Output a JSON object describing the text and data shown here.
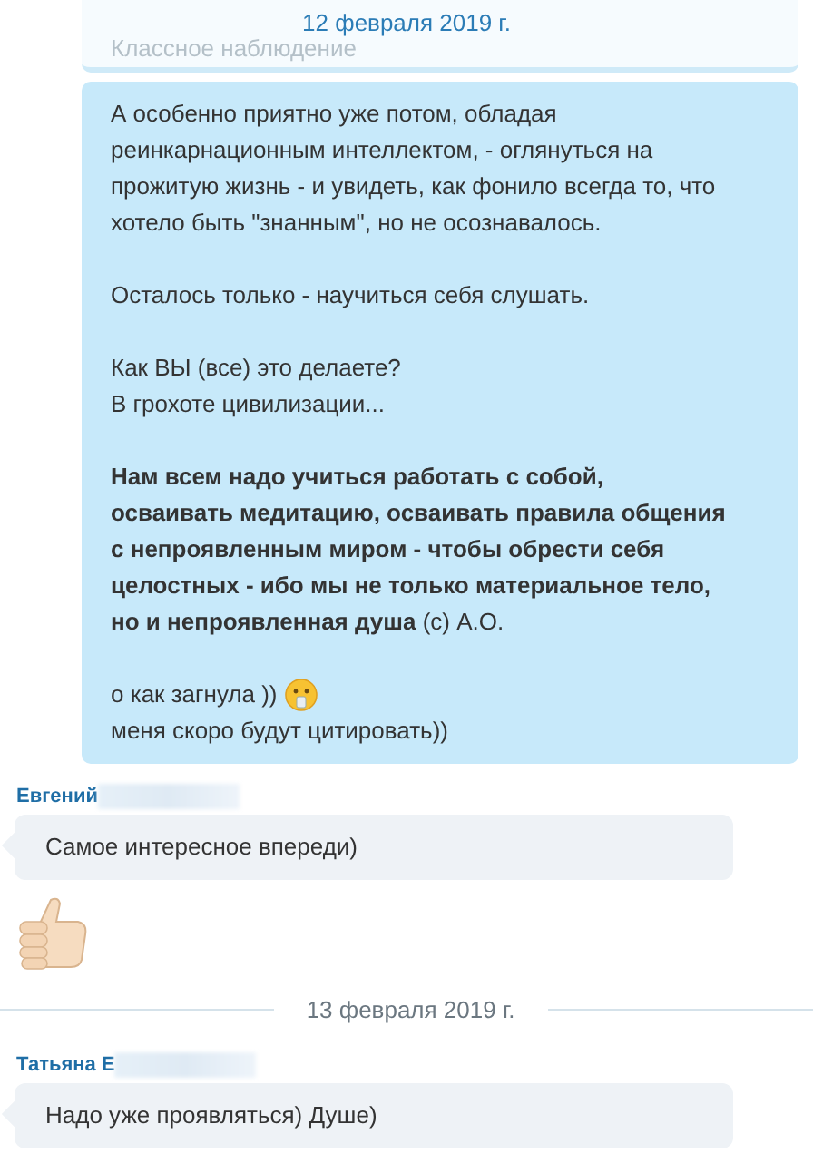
{
  "sticky_date": "12 февраля 2019 г.",
  "messages": [
    {
      "kind": "outgoing",
      "faded": true,
      "blocks": [
        [
          {
            "text": "Классное наблюдение"
          }
        ]
      ]
    },
    {
      "kind": "outgoing",
      "blocks": [
        [
          {
            "text": "А особенно приятно уже потом, обладая реинкарнационным интеллектом, - оглянуться на прожитую жизнь - и увидеть, как фонило всегда то, что хотело быть \"знанным\", но не осознавалось."
          }
        ],
        [
          {
            "text": "Осталось только - научиться себя слушать."
          }
        ],
        [
          {
            "text": "Как ВЫ (все) это делаете?"
          },
          {
            "text": "В грохоте цивилизации..."
          }
        ],
        [
          {
            "text": "**Нам всем надо учиться работать с собой, осваивать медитацию, осваивать правила общения с непроявленным миром - чтобы обрести себя целостных - ибо мы не только материальное тело, но и непроявленная душа** (с)  А.О."
          }
        ],
        [
          {
            "text": "о как загнула ))",
            "emoji": true
          },
          {
            "text": "меня скоро будут цитировать))"
          }
        ]
      ]
    },
    {
      "kind": "incoming",
      "sender": "Евгений",
      "blocks": [
        [
          {
            "text": "Самое интересное впереди)"
          }
        ]
      ]
    },
    {
      "kind": "sticker"
    },
    {
      "kind": "date",
      "text": "13 февраля 2019 г."
    },
    {
      "kind": "incoming",
      "sender": "Татьяна Е",
      "blocks": [
        [
          {
            "text": "Надо  уже проявляться) Душе)"
          }
        ]
      ]
    }
  ]
}
